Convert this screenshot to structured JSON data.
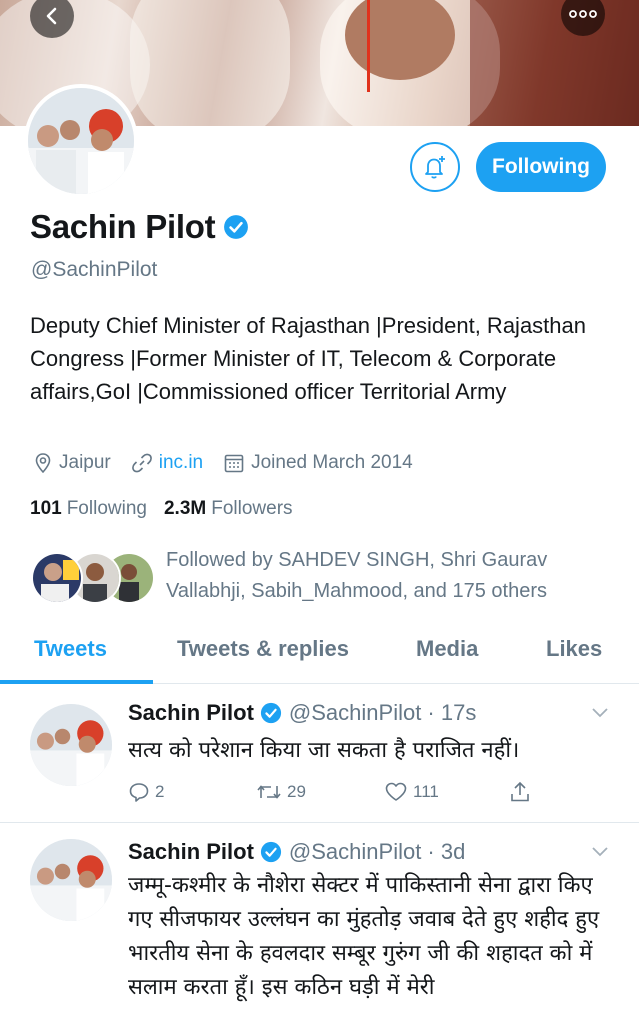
{
  "profile": {
    "name": "Sachin Pilot",
    "handle": "@SachinPilot",
    "bio": "Deputy Chief Minister of Rajasthan |President, Rajasthan Congress |Former Minister of IT, Telecom & Corporate affairs,GoI |Commissioned officer Territorial Army",
    "location": "Jaipur",
    "website": "inc.in",
    "joined": "Joined March 2014",
    "following_count": "101",
    "following_label": "Following",
    "followers_count": "2.3M",
    "followers_label": "Followers",
    "followed_by": "Followed by SAHDEV SINGH, Shri Gaurav Vallabhji, Sabih_Mahmood, and 175 others"
  },
  "buttons": {
    "follow_state": "Following"
  },
  "tabs": [
    {
      "label": "Tweets",
      "active": true
    },
    {
      "label": "Tweets & replies",
      "active": false
    },
    {
      "label": "Media",
      "active": false
    },
    {
      "label": "Likes",
      "active": false
    }
  ],
  "tweets": [
    {
      "name": "Sachin Pilot",
      "handle": "@SachinPilot · 17s",
      "text": "सत्य को परेशान किया जा सकता है पराजित नहीं।",
      "replies": "2",
      "retweets": "29",
      "likes": "111"
    },
    {
      "name": "Sachin Pilot",
      "handle": "@SachinPilot · 3d",
      "text": "जम्मू-कश्मीर के नौशेरा सेक्टर में पाकिस्तानी सेना द्वारा किए गए सीजफायर उल्लंघन का मुंहतोड़ जवाब देते हुए शहीद हुए भारतीय सेना के हवलदार सम्बूर गुरुंग जी की शहादत को में सलाम करता हूँ। इस कठिन घड़ी में मेरी"
    }
  ],
  "colors": {
    "accent": "#1da1f2",
    "text_primary": "#14171a",
    "text_secondary": "#657786",
    "divider": "#e1e8ed"
  },
  "icons": [
    "back-arrow-icon",
    "more-dots-icon",
    "bell-plus-icon",
    "verified-badge-icon",
    "location-pin-icon",
    "link-icon",
    "calendar-icon",
    "reply-icon",
    "retweet-icon",
    "like-heart-icon",
    "share-icon",
    "chevron-down-icon"
  ]
}
